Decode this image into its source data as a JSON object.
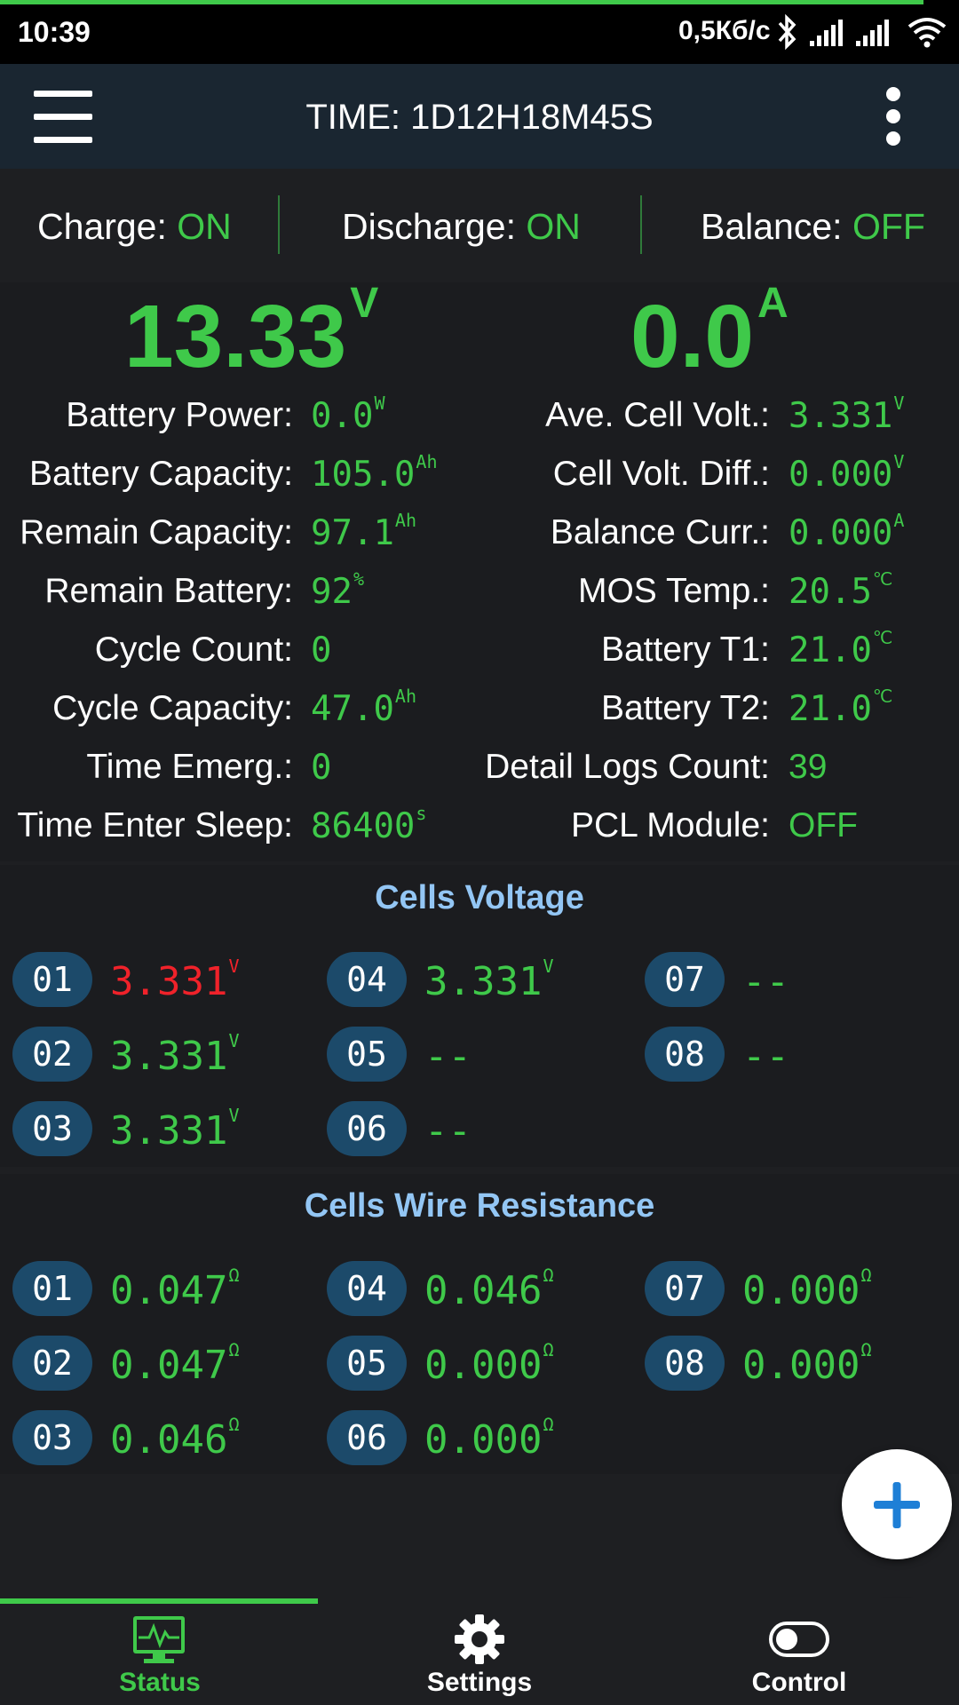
{
  "status_bar": {
    "time": "10:39",
    "network_speed": "0,5Кб/с"
  },
  "toolbar": {
    "title": "TIME: 1D12H18M45S"
  },
  "states": {
    "charge_label": "Charge: ",
    "charge_value": "ON",
    "discharge_label": "Discharge: ",
    "discharge_value": "ON",
    "balance_label": "Balance: ",
    "balance_value": "OFF"
  },
  "main": {
    "voltage": "13.33",
    "voltage_unit": "V",
    "current": "0.0",
    "current_unit": "A"
  },
  "left_info": [
    {
      "label": "Battery Power:",
      "value": "0.0",
      "unit": "W"
    },
    {
      "label": "Battery Capacity:",
      "value": "105.0",
      "unit": "Ah"
    },
    {
      "label": "Remain Capacity:",
      "value": "97.1",
      "unit": "Ah"
    },
    {
      "label": "Remain Battery:",
      "value": "92",
      "unit": "%"
    },
    {
      "label": "Cycle Count:",
      "value": "0",
      "unit": ""
    },
    {
      "label": "Cycle Capacity:",
      "value": "47.0",
      "unit": "Ah"
    },
    {
      "label": "Time Emerg.:",
      "value": "0",
      "unit": ""
    },
    {
      "label": "Time Enter Sleep:",
      "value": "86400",
      "unit": "s"
    }
  ],
  "right_info": [
    {
      "label": "Ave. Cell Volt.:",
      "value": "3.331",
      "unit": "V"
    },
    {
      "label": "Cell Volt. Diff.:",
      "value": "0.000",
      "unit": "V"
    },
    {
      "label": "Balance Curr.:",
      "value": "0.000",
      "unit": "A"
    },
    {
      "label": "MOS Temp.:",
      "value": "20.5",
      "unit": "℃"
    },
    {
      "label": "Battery T1:",
      "value": "21.0",
      "unit": "℃"
    },
    {
      "label": "Battery T2:",
      "value": "21.0",
      "unit": "℃"
    },
    {
      "label": "Detail Logs Count:",
      "value": "39",
      "unit": ""
    },
    {
      "label": "PCL Module:",
      "value": "OFF",
      "unit": ""
    }
  ],
  "cells_voltage": {
    "title": "Cells Voltage",
    "cells": [
      {
        "id": "01",
        "value": "3.331",
        "unit": "V",
        "highlight": "#f0222a"
      },
      {
        "id": "02",
        "value": "3.331",
        "unit": "V"
      },
      {
        "id": "03",
        "value": "3.331",
        "unit": "V"
      },
      {
        "id": "04",
        "value": "3.331",
        "unit": "V"
      },
      {
        "id": "05",
        "value": "--",
        "unit": ""
      },
      {
        "id": "06",
        "value": "--",
        "unit": ""
      },
      {
        "id": "07",
        "value": "--",
        "unit": ""
      },
      {
        "id": "08",
        "value": "--",
        "unit": ""
      }
    ]
  },
  "cells_resistance": {
    "title": "Cells Wire Resistance",
    "cells": [
      {
        "id": "01",
        "value": "0.047",
        "unit": "Ω"
      },
      {
        "id": "02",
        "value": "0.047",
        "unit": "Ω"
      },
      {
        "id": "03",
        "value": "0.046",
        "unit": "Ω"
      },
      {
        "id": "04",
        "value": "0.046",
        "unit": "Ω"
      },
      {
        "id": "05",
        "value": "0.000",
        "unit": "Ω"
      },
      {
        "id": "06",
        "value": "0.000",
        "unit": "Ω"
      },
      {
        "id": "07",
        "value": "0.000",
        "unit": "Ω"
      },
      {
        "id": "08",
        "value": "0.000",
        "unit": "Ω"
      }
    ]
  },
  "fabs": {
    "plus_icon": "plus-icon",
    "minus_icon": "minus-icon",
    "color": "#1e7fd6"
  },
  "bottom_nav": {
    "items": [
      {
        "label": "Status",
        "icon": "monitor-pulse-icon",
        "active": true
      },
      {
        "label": "Settings",
        "icon": "gear-icon",
        "active": false
      },
      {
        "label": "Control",
        "icon": "toggle-icon",
        "active": false
      }
    ],
    "accent": "#3fc94a"
  }
}
